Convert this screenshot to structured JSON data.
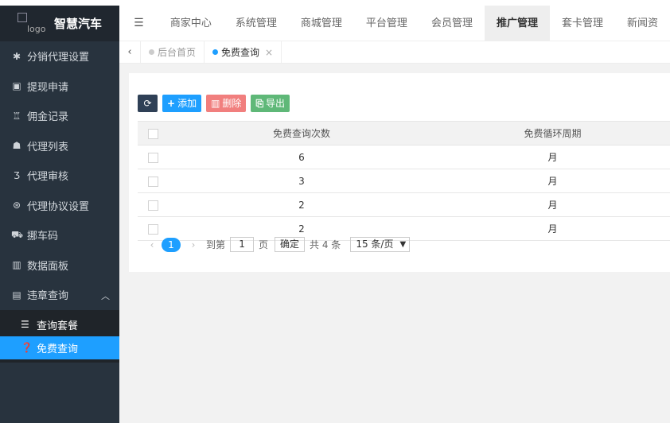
{
  "brand": {
    "logo_alt": "logo",
    "name": "智慧汽车"
  },
  "sidebar": {
    "items": [
      {
        "icon": "gear-icon",
        "glyph": "✱",
        "label": "分销代理设置"
      },
      {
        "icon": "money-icon",
        "glyph": "▣",
        "label": "提现申请"
      },
      {
        "icon": "trophy-icon",
        "glyph": "♖",
        "label": "佣金记录"
      },
      {
        "icon": "users-icon",
        "glyph": "☗",
        "label": "代理列表"
      },
      {
        "icon": "css3-icon",
        "glyph": "Ʒ",
        "label": "代理审核"
      },
      {
        "icon": "ban-icon",
        "glyph": "⊛",
        "label": "代理协议设置"
      },
      {
        "icon": "car-icon",
        "glyph": "⛟",
        "label": "挪车码"
      },
      {
        "icon": "bar-chart-icon",
        "glyph": "▥",
        "label": "数据面板"
      },
      {
        "icon": "newspaper-icon",
        "glyph": "▤",
        "label": "违章查询"
      }
    ],
    "submenu": [
      {
        "icon": "list-icon",
        "glyph": "☰",
        "label": "查询套餐"
      },
      {
        "icon": "question-circle-icon",
        "glyph": "❓",
        "label": "免费查询"
      }
    ]
  },
  "topnav": {
    "items": [
      "商家中心",
      "系统管理",
      "商城管理",
      "平台管理",
      "会员管理",
      "推广管理",
      "套卡管理",
      "新闻资"
    ],
    "active_index": 5
  },
  "tabs": {
    "items": [
      {
        "label": "后台首页"
      },
      {
        "label": "免费查询",
        "close": "×"
      }
    ]
  },
  "toolbar": {
    "add": "添加",
    "delete": "删除",
    "export": "导出"
  },
  "table": {
    "headers": [
      "免费查询次数",
      "免费循环周期"
    ],
    "rows": [
      [
        "6",
        "月"
      ],
      [
        "3",
        "月"
      ],
      [
        "2",
        "月"
      ],
      [
        "2",
        "月"
      ]
    ]
  },
  "pager": {
    "current": "1",
    "goto_prefix": "到第",
    "goto_value": "1",
    "goto_suffix": "页",
    "confirm": "确定",
    "total": "共 4 条",
    "page_size": "15 条/页"
  },
  "colors": {
    "sidebar_bg": "#28333e",
    "accent": "#1e9fff",
    "delete": "#f17f7e",
    "export": "#5fb878"
  }
}
